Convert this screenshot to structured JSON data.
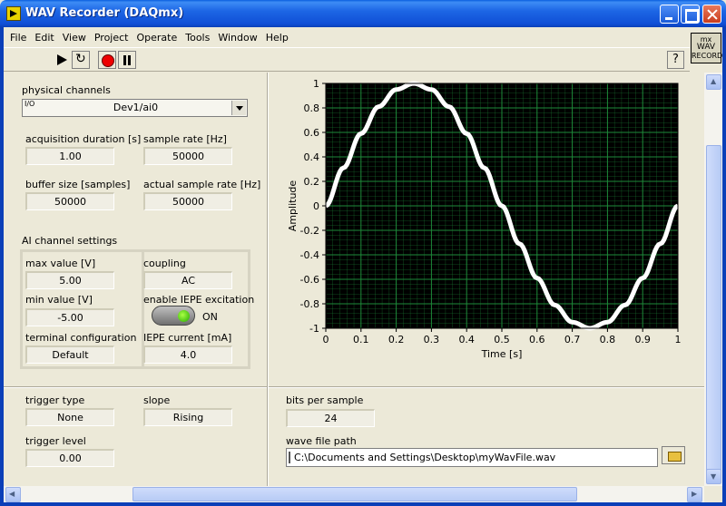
{
  "window": {
    "title": "WAV Recorder (DAQmx)"
  },
  "menu": [
    "File",
    "Edit",
    "View",
    "Project",
    "Operate",
    "Tools",
    "Window",
    "Help"
  ],
  "toolbar": {
    "help": "?"
  },
  "vi_icon": {
    "line1": "mx",
    "line2": "WAV",
    "line3": "RECORD"
  },
  "physical_channels": {
    "label": "physical channels",
    "radix": "I/O",
    "value": "Dev1/ai0"
  },
  "acquisition_duration": {
    "label": "acquisition duration [s]",
    "value": "1.00"
  },
  "sample_rate": {
    "label": "sample rate [Hz]",
    "value": "50000"
  },
  "buffer_size": {
    "label": "buffer size [samples]",
    "value": "50000"
  },
  "actual_sample_rate": {
    "label": "actual sample rate [Hz]",
    "value": "50000"
  },
  "ai_settings": {
    "label": "AI channel settings",
    "max_value": {
      "label": "max value [V]",
      "value": "5.00"
    },
    "min_value": {
      "label": "min value [V]",
      "value": "-5.00"
    },
    "terminal_config": {
      "label": "terminal configuration",
      "value": "Default"
    },
    "coupling": {
      "label": "coupling",
      "value": "AC"
    },
    "iepe_enable": {
      "label": "enable IEPE excitation",
      "state": "ON"
    },
    "iepe_current": {
      "label": "IEPE current [mA]",
      "value": "4.0"
    }
  },
  "trigger_type": {
    "label": "trigger type",
    "value": "None"
  },
  "slope": {
    "label": "slope",
    "value": "Rising"
  },
  "trigger_level": {
    "label": "trigger level",
    "value": "0.00"
  },
  "bits_per_sample": {
    "label": "bits per sample",
    "value": "24"
  },
  "wave_file_path": {
    "label": "wave file path",
    "value": "C:\\Documents and Settings\\Desktop\\myWavFile.wav"
  },
  "chart_data": {
    "type": "line",
    "xlabel": "Time [s]",
    "ylabel": "Amplitude",
    "xlim": [
      0,
      1
    ],
    "ylim": [
      -1,
      1
    ],
    "xticks": [
      "0",
      "0.1",
      "0.2",
      "0.3",
      "0.4",
      "0.5",
      "0.6",
      "0.7",
      "0.8",
      "0.9",
      "1"
    ],
    "yticks": [
      "1",
      "0.8",
      "0.6",
      "0.4",
      "0.2",
      "0",
      "-0.2",
      "-0.4",
      "-0.6",
      "-0.8",
      "-1"
    ],
    "grid": true,
    "background": "#000000",
    "grid_color": "#1e8a3a",
    "line_color": "#ffffff",
    "series": [
      {
        "x": [
          0,
          0.05,
          0.1,
          0.15,
          0.2,
          0.25,
          0.3,
          0.35,
          0.4,
          0.45,
          0.5,
          0.55,
          0.6,
          0.65,
          0.7,
          0.75,
          0.8,
          0.85,
          0.9,
          0.95,
          1.0
        ],
        "y": [
          0,
          0.31,
          0.59,
          0.81,
          0.95,
          1.0,
          0.95,
          0.81,
          0.59,
          0.31,
          0,
          -0.31,
          -0.59,
          -0.81,
          -0.95,
          -1.0,
          -0.95,
          -0.81,
          -0.59,
          -0.31,
          0
        ]
      }
    ]
  }
}
